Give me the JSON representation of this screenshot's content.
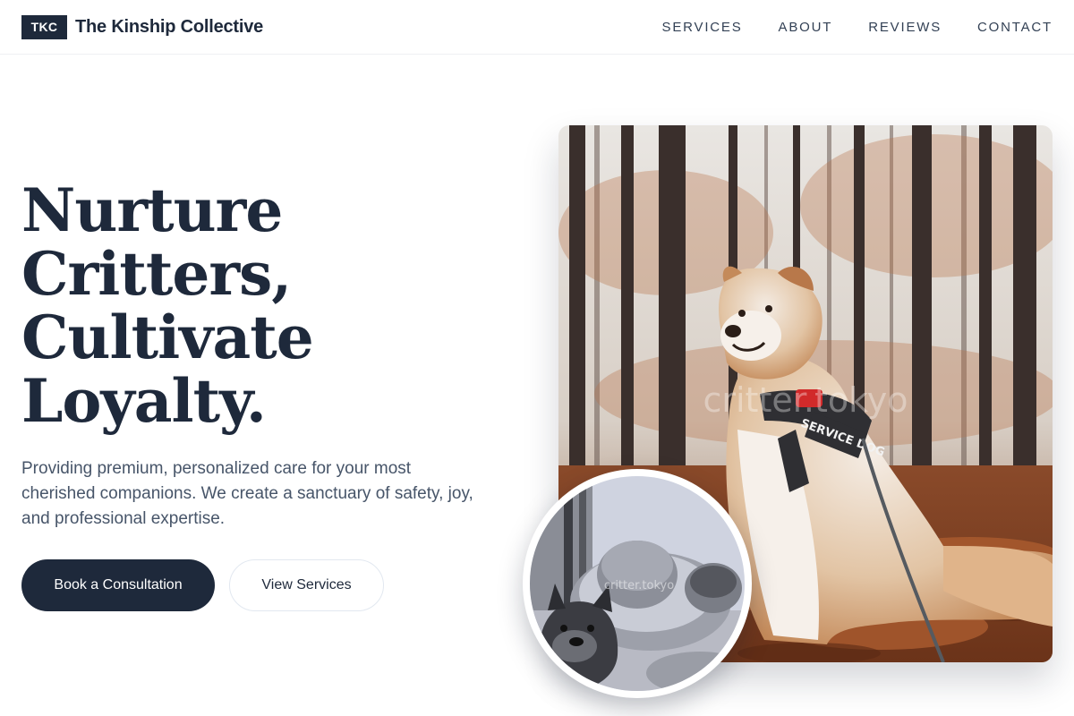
{
  "brand": {
    "mark": "TKC",
    "name": "The Kinship Collective"
  },
  "nav": {
    "items": [
      {
        "label": "SERVICES"
      },
      {
        "label": "ABOUT"
      },
      {
        "label": "REVIEWS"
      },
      {
        "label": "CONTACT"
      }
    ]
  },
  "hero": {
    "title_lines": [
      "Nurture",
      "Critters,",
      "Cultivate",
      "Loyalty."
    ],
    "subtitle": "Providing premium, personalized care for your most cherished companions. We create a sanctuary of safety, joy, and professional expertise.",
    "primary_button": "Book a Consultation",
    "secondary_button": "View Services"
  },
  "photos": {
    "main": {
      "vest_text": "SERVICE DOG",
      "watermark": "critter.tokyo"
    },
    "inset": {
      "watermark": "critter.tokyo"
    }
  },
  "colors": {
    "primary": "#1e293b",
    "text_muted": "#475569",
    "border": "#e2e8f0"
  }
}
